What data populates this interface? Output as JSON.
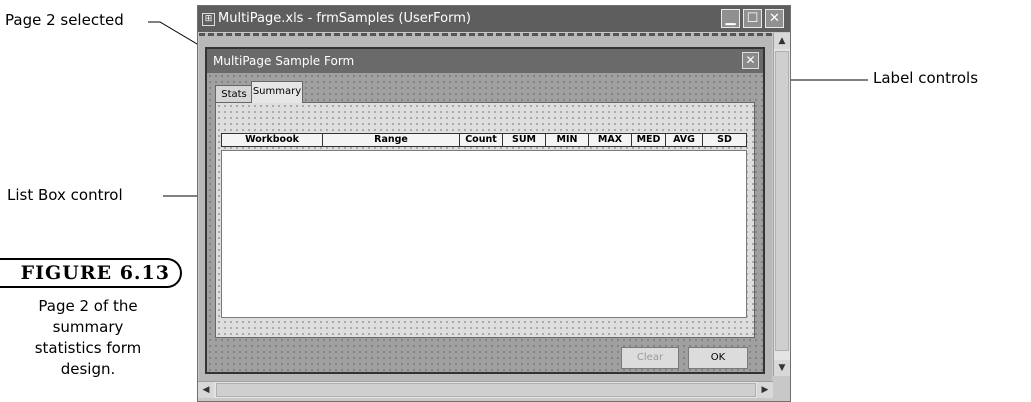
{
  "callouts": {
    "page2": "Page 2 selected",
    "listbox": "List Box control",
    "labels": "Label controls"
  },
  "figure": {
    "number": "FIGURE 6.13",
    "caption_lines": [
      "Page 2 of the",
      "summary",
      "statistics form",
      "design."
    ]
  },
  "ide": {
    "title": "MultiPage.xls - frmSamples (UserForm)",
    "min": "▁",
    "max": "☐",
    "close": "✕"
  },
  "form": {
    "title": "MultiPage Sample Form",
    "close": "✕",
    "tabs": [
      "Stats",
      "Summary"
    ],
    "selected_tab": "Summary",
    "headers": [
      "Workbook",
      "Range",
      "Count",
      "SUM",
      "MIN",
      "MAX",
      "MED",
      "AVG",
      "SD"
    ],
    "buttons": {
      "clear": "Clear",
      "ok": "OK"
    }
  },
  "colors": {
    "title_bar": "#5e5e5e",
    "form_title_bar": "#6a6a6a"
  },
  "icons": [
    "window-menu-icon",
    "minimize-icon",
    "maximize-icon",
    "close-icon",
    "scroll-up-icon",
    "scroll-down-icon",
    "scroll-left-icon",
    "scroll-right-icon"
  ]
}
